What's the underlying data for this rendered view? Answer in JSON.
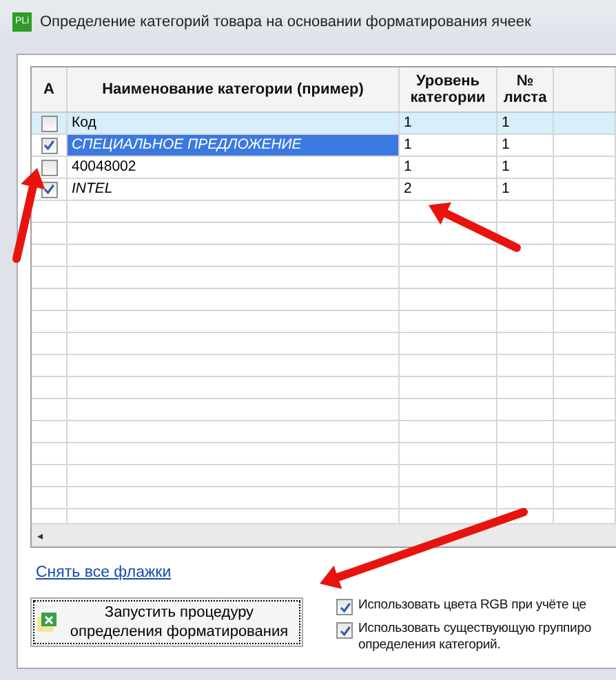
{
  "window": {
    "icon_text": "PLi",
    "title": "Определение категорий товара на основании форматирования ячеек"
  },
  "table": {
    "columns": [
      "А",
      "Наименование категории (пример)",
      "Уровень категории",
      "№ листа"
    ],
    "rows": [
      {
        "checked": false,
        "current": true,
        "selected": false,
        "italic": false,
        "name": "Код",
        "level_text": "1",
        "sheet": "1"
      },
      {
        "checked": true,
        "current": false,
        "selected": true,
        "italic": true,
        "name": "СПЕЦИАЛЬНОЕ ПРЕДЛОЖЕНИЕ",
        "level_text": "1",
        "sheet": "1"
      },
      {
        "checked": false,
        "current": false,
        "selected": false,
        "italic": false,
        "name": "40048002",
        "level_text": "1",
        "sheet": "1"
      },
      {
        "checked": true,
        "current": false,
        "selected": false,
        "italic": true,
        "name": "INTEL",
        "level_text": "2",
        "sheet": "1"
      }
    ],
    "scroll_left": "◂"
  },
  "clear_link": "Снять все флажки",
  "run_button": "Запустить процедуру определения форматирования",
  "options": [
    {
      "label": "Использовать цвета RGB при учёте це",
      "checked": true
    },
    {
      "label": "Использовать существующую группиро\nопределения категорий.",
      "checked": true
    }
  ]
}
